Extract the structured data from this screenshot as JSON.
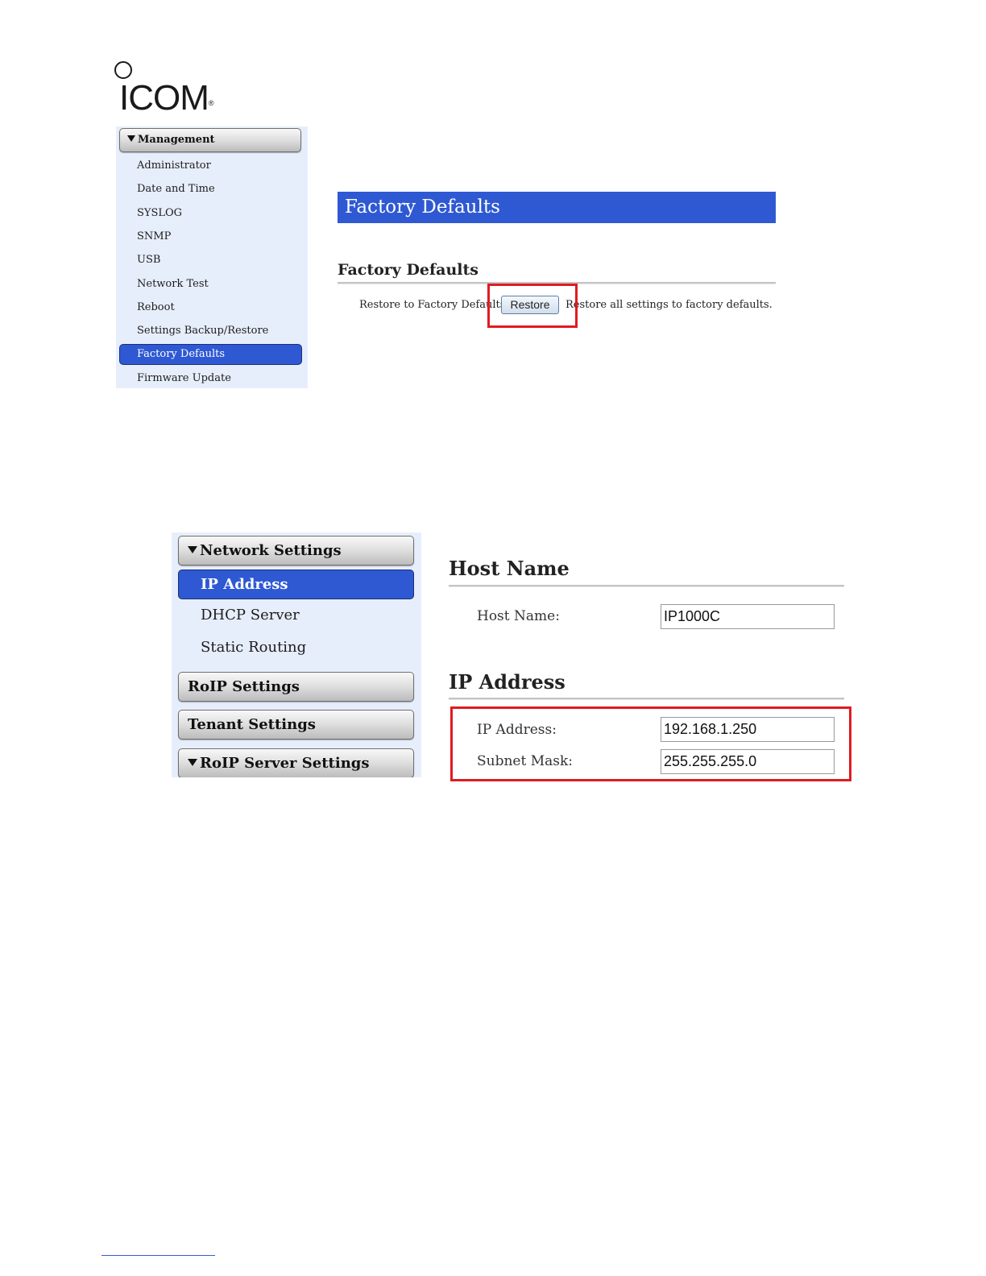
{
  "logo": {
    "brand": "ICOM",
    "reg_mark": "®"
  },
  "panel1": {
    "sidebar": {
      "section": "Management",
      "items": [
        "Administrator",
        "Date and Time",
        "SYSLOG",
        "SNMP",
        "USB",
        "Network Test",
        "Reboot",
        "Settings Backup/Restore",
        "Factory Defaults",
        "Firmware Update"
      ],
      "active_item": "Factory Defaults"
    },
    "page_title": "Factory Defaults",
    "section_title": "Factory Defaults",
    "restore_label": "Restore to Factory Defaults:",
    "restore_button": "Restore",
    "restore_description": "Restore all settings to factory defaults."
  },
  "panel2": {
    "sidebar": {
      "network_settings": "Network Settings",
      "items": [
        "IP Address",
        "DHCP Server",
        "Static Routing"
      ],
      "active_item": "IP Address",
      "roip_settings": "RoIP Settings",
      "tenant_settings": "Tenant Settings",
      "roip_server_settings": "RoIP Server Settings"
    },
    "host_section_title": "Host Name",
    "host_name_label": "Host Name:",
    "host_name_value": "IP1000C",
    "ip_section_title": "IP Address",
    "ip_address_label": "IP Address:",
    "ip_address_value": "192.168.1.250",
    "subnet_mask_label": "Subnet Mask:",
    "subnet_mask_value": "255.255.255.0"
  },
  "colors": {
    "accent_blue": "#2f59d3",
    "sidebar_bg": "#e7eefb",
    "highlight_red": "#e01b22"
  }
}
